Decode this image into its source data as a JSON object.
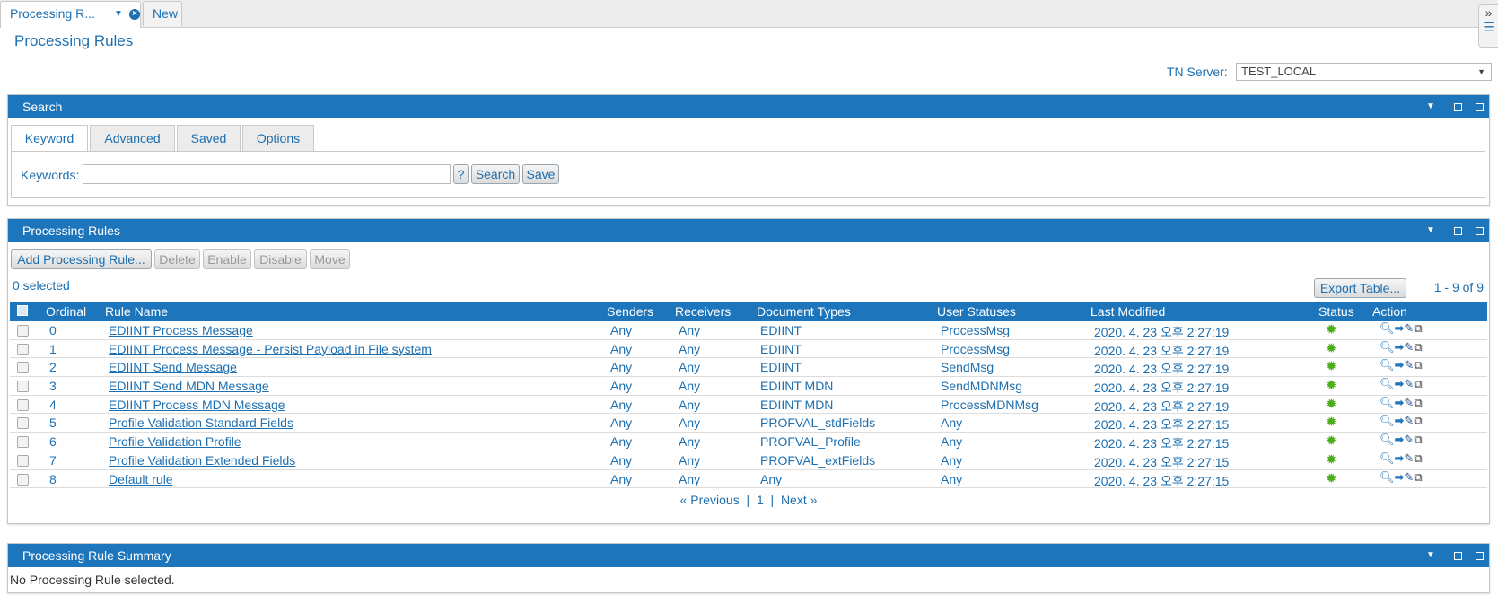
{
  "tabs": [
    {
      "label": "Processing R..."
    },
    {
      "label": "New"
    }
  ],
  "page_title": "Processing Rules",
  "tn_server": {
    "label": "TN Server:",
    "value": "TEST_LOCAL"
  },
  "search": {
    "title": "Search",
    "tabs": [
      "Keyword",
      "Advanced",
      "Saved",
      "Options"
    ],
    "keywords_label": "Keywords:",
    "keywords_value": "",
    "help_label": "?",
    "search_label": "Search",
    "save_label": "Save"
  },
  "rules": {
    "title": "Processing Rules",
    "buttons": {
      "add": "Add Processing Rule...",
      "delete": "Delete",
      "enable": "Enable",
      "disable": "Disable",
      "move": "Move"
    },
    "selected": "0 selected",
    "export": "Export Table...",
    "range": "1 - 9 of 9",
    "columns": [
      "Ordinal",
      "Rule Name",
      "Senders",
      "Receivers",
      "Document Types",
      "User Statuses",
      "Last Modified",
      "Status",
      "Action"
    ],
    "rows": [
      {
        "ordinal": "0",
        "name": "EDIINT Process Message",
        "senders": "Any",
        "receivers": "Any",
        "doctypes": "EDIINT",
        "statuses": "ProcessMsg",
        "modified": "2020. 4. 23 오후 2:27:19"
      },
      {
        "ordinal": "1",
        "name": "EDIINT Process Message - Persist Payload in File system",
        "senders": "Any",
        "receivers": "Any",
        "doctypes": "EDIINT",
        "statuses": "ProcessMsg",
        "modified": "2020. 4. 23 오후 2:27:19"
      },
      {
        "ordinal": "2",
        "name": "EDIINT Send Message",
        "senders": "Any",
        "receivers": "Any",
        "doctypes": "EDIINT",
        "statuses": "SendMsg",
        "modified": "2020. 4. 23 오후 2:27:19"
      },
      {
        "ordinal": "3",
        "name": "EDIINT Send MDN Message",
        "senders": "Any",
        "receivers": "Any",
        "doctypes": "EDIINT MDN",
        "statuses": "SendMDNMsg",
        "modified": "2020. 4. 23 오후 2:27:19"
      },
      {
        "ordinal": "4",
        "name": "EDIINT Process MDN Message",
        "senders": "Any",
        "receivers": "Any",
        "doctypes": "EDIINT MDN",
        "statuses": "ProcessMDNMsg",
        "modified": "2020. 4. 23 오후 2:27:19"
      },
      {
        "ordinal": "5",
        "name": "Profile Validation Standard Fields",
        "senders": "Any",
        "receivers": "Any",
        "doctypes": "PROFVAL_stdFields",
        "statuses": "Any",
        "modified": "2020. 4. 23 오후 2:27:15"
      },
      {
        "ordinal": "6",
        "name": "Profile Validation Profile",
        "senders": "Any",
        "receivers": "Any",
        "doctypes": "PROFVAL_Profile",
        "statuses": "Any",
        "modified": "2020. 4. 23 오후 2:27:15"
      },
      {
        "ordinal": "7",
        "name": "Profile Validation Extended Fields",
        "senders": "Any",
        "receivers": "Any",
        "doctypes": "PROFVAL_extFields",
        "statuses": "Any",
        "modified": "2020. 4. 23 오후 2:27:15"
      },
      {
        "ordinal": "8",
        "name": "Default rule",
        "senders": "Any",
        "receivers": "Any",
        "doctypes": "Any",
        "statuses": "Any",
        "modified": "2020. 4. 23 오후 2:27:15"
      }
    ],
    "pager": {
      "prev": "« Previous",
      "sep": "|",
      "page": "1",
      "next": "Next »"
    }
  },
  "summary": {
    "title": "Processing Rule Summary",
    "text": "No Processing Rule selected."
  }
}
